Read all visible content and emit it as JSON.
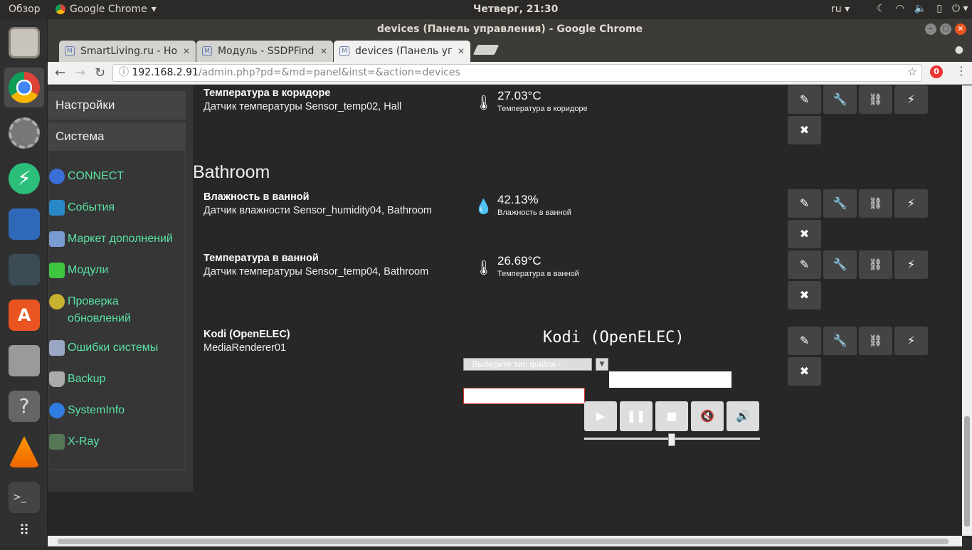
{
  "os": {
    "overview": "Обзор",
    "app_name": "Google Chrome",
    "clock": "Четверг, 21:30",
    "lang": "ru"
  },
  "window": {
    "title": "devices (Панель управления) - Google Chrome"
  },
  "tabs": [
    {
      "title": "SmartLiving.ru - Ho"
    },
    {
      "title": "Модуль - SSDPFind"
    },
    {
      "title": "devices (Панель уп"
    }
  ],
  "url": {
    "host": "192.168.2.91",
    "path": "/admin.php?pd=&md=panel&inst=&action=devices"
  },
  "sidebar": {
    "headers": [
      "Настройки",
      "Система"
    ],
    "links": [
      {
        "label": "CONNECT",
        "icon": "globe-icon",
        "color": "#3a6fd8"
      },
      {
        "label": "События",
        "icon": "laptop-icon",
        "color": "#2b88c8"
      },
      {
        "label": "Маркет дополнений",
        "icon": "puzzle-icon",
        "color": "#7a9bd0"
      },
      {
        "label": "Модули",
        "icon": "green-puzzle-icon",
        "color": "#3fc63f"
      },
      {
        "label": "Проверка обновлений",
        "icon": "update-icon",
        "color": "#c8b030"
      },
      {
        "label": "Ошибки системы",
        "icon": "error-icon",
        "color": "#9aa7c4"
      },
      {
        "label": "Backup",
        "icon": "database-icon",
        "color": "#aaaaaa"
      },
      {
        "label": "SystemInfo",
        "icon": "info-icon",
        "color": "#2f7de0"
      },
      {
        "label": "X-Ray",
        "icon": "xray-icon",
        "color": "#557755"
      }
    ]
  },
  "room_heading": "Bathroom",
  "devices": [
    {
      "title": "Температура в коридоре",
      "desc": "Датчик температуры Sensor_temp02, Hall",
      "value": "27.03°C",
      "label": "Температура в коридоре",
      "icon": "thermometer-icon"
    },
    {
      "title": "Влажность в ванной",
      "desc": "Датчик влажности Sensor_humidity04, Bathroom",
      "value": "42.13%",
      "label": "Влажность в ванной",
      "icon": "droplet-icon"
    },
    {
      "title": "Температура в ванной",
      "desc": "Датчик температуры Sensor_temp04, Bathroom",
      "value": "26.69°C",
      "label": "Температура в ванной",
      "icon": "thermometer-icon"
    },
    {
      "title": "Kodi (OpenELEC)",
      "desc": "MediaRenderer01"
    }
  ],
  "kodi": {
    "title": "Kodi (OpenELEC)",
    "select_placeholder": "- Выберите тип файла -"
  },
  "actions": {
    "edit": "✎",
    "settings": "🔧",
    "link": "⛓",
    "power": "⚡",
    "delete": "✖"
  }
}
